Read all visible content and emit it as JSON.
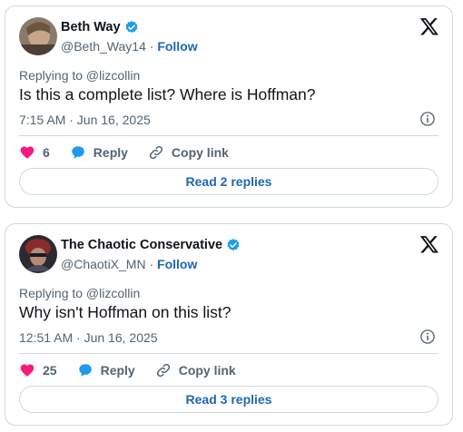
{
  "tweets": [
    {
      "author": {
        "name": "Beth Way",
        "handle": "@Beth_Way14",
        "separator": "·",
        "follow_label": "Follow"
      },
      "replying_to": "Replying to @lizcollin",
      "text": "Is this a complete list? Where is Hoffman?",
      "timestamp": "7:15 AM · Jun 16, 2025",
      "likes": "6",
      "reply_label": "Reply",
      "copy_link_label": "Copy link",
      "read_replies_label": "Read 2 replies"
    },
    {
      "author": {
        "name": "The Chaotic Conservative",
        "handle": "@ChaotiX_MN",
        "separator": "·",
        "follow_label": "Follow"
      },
      "replying_to": "Replying to @lizcollin",
      "text": "Why isn't Hoffman on this list?",
      "timestamp": "12:51 AM · Jun 16, 2025",
      "likes": "25",
      "reply_label": "Reply",
      "copy_link_label": "Copy link",
      "read_replies_label": "Read 3 replies"
    }
  ],
  "icons": {
    "verified": "verified-badge-icon",
    "x_logo": "x-logo-icon",
    "info": "info-icon",
    "like": "heart-icon",
    "reply": "reply-bubble-icon",
    "copy_link": "link-icon"
  },
  "colors": {
    "link": "#1d67b5",
    "heart": "#f91880",
    "reply": "#1d9bf0",
    "verified": "#1d9bf0",
    "muted": "#536471",
    "border": "#cfd9de"
  }
}
